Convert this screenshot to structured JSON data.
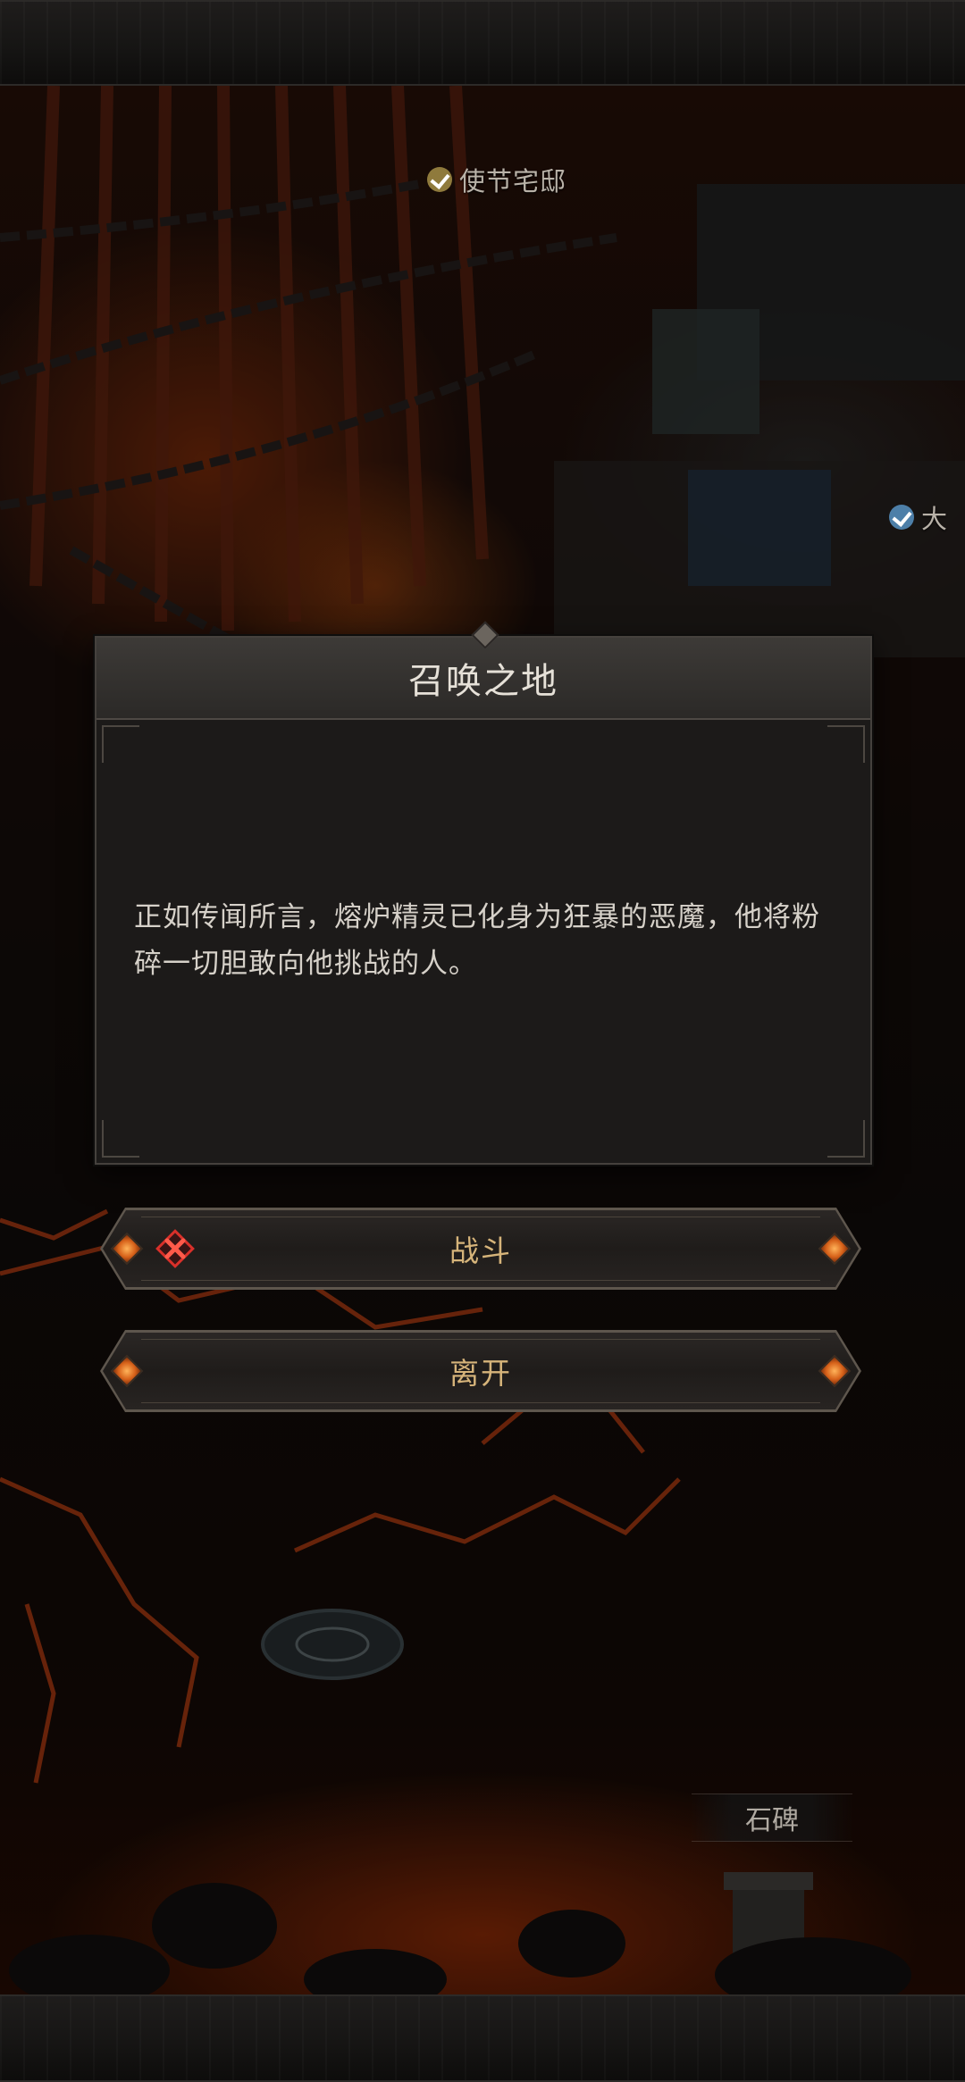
{
  "map": {
    "labels": {
      "envoy_residence": "使节宅邸",
      "partial_right": "大",
      "stele": "石碑"
    }
  },
  "dialog": {
    "title": "召唤之地",
    "body": "正如传闻所言，熔炉精灵已化身为狂暴的恶魔，他将粉碎一切胆敢向他挑战的人。"
  },
  "choices": {
    "fight": "战斗",
    "leave": "离开"
  },
  "colors": {
    "accent_gold": "#d6b47a",
    "lava": "#e2561a",
    "panel": "#1c1a19",
    "danger": "#d9302a"
  }
}
